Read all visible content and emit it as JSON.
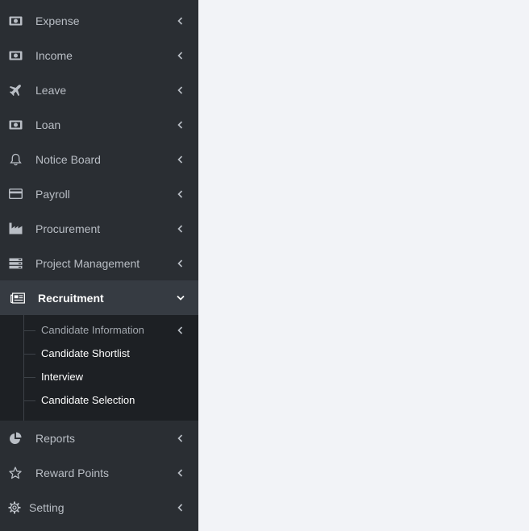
{
  "sidebar": {
    "items": [
      {
        "label": "Expense",
        "icon": "money-icon"
      },
      {
        "label": "Income",
        "icon": "money-icon"
      },
      {
        "label": "Leave",
        "icon": "plane-icon"
      },
      {
        "label": "Loan",
        "icon": "money-icon"
      },
      {
        "label": "Notice Board",
        "icon": "bell-icon"
      },
      {
        "label": "Payroll",
        "icon": "credit-card-icon"
      },
      {
        "label": "Procurement",
        "icon": "industry-icon"
      },
      {
        "label": "Project Management",
        "icon": "server-icon"
      },
      {
        "label": "Recruitment",
        "icon": "newspaper-icon",
        "expanded": true
      },
      {
        "label": "Reports",
        "icon": "pie-chart-icon"
      },
      {
        "label": "Reward Points",
        "icon": "star-icon"
      },
      {
        "label": "Setting",
        "icon": "gear-icon"
      }
    ],
    "recruitment_submenu": [
      {
        "label": "Candidate Information",
        "has_children": true
      },
      {
        "label": "Candidate Shortlist"
      },
      {
        "label": "Interview"
      },
      {
        "label": "Candidate Selection"
      }
    ]
  },
  "colors": {
    "sidebar_bg": "#2a2e33",
    "submenu_bg": "#1d2024",
    "active_bg": "#363b42",
    "content_bg": "#f2f3f7",
    "text_muted": "#b9bec5",
    "text_active": "#ffffff"
  }
}
